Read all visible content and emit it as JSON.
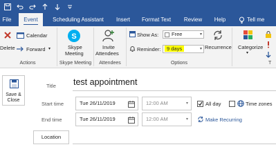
{
  "quick_access": {
    "icons": [
      "save-icon",
      "undo-icon",
      "redo-icon",
      "up-icon",
      "down-icon",
      "customize-icon"
    ]
  },
  "tabs": [
    {
      "label": "File",
      "active": false
    },
    {
      "label": "Event",
      "active": true
    },
    {
      "label": "Scheduling Assistant",
      "active": false
    },
    {
      "label": "Insert",
      "active": false
    },
    {
      "label": "Format Text",
      "active": false
    },
    {
      "label": "Review",
      "active": false
    },
    {
      "label": "Help",
      "active": false
    }
  ],
  "tell_me": "Tell me",
  "ribbon": {
    "delete_label": "Delete",
    "calendar_label": "Calendar",
    "forward_label": "Forward",
    "actions_label": "Actions",
    "skype_label_1": "Skype",
    "skype_label_2": "Meeting",
    "skype_group_label": "Skype Meeting",
    "invite_label_1": "Invite",
    "invite_label_2": "Attendees",
    "attendees_group_label": "Attendees",
    "show_as_label": "Show As:",
    "show_as_value": "Free",
    "reminder_label": "Reminder:",
    "reminder_value": "9 days",
    "recurrence_label": "Recurrence",
    "options_label": "Options",
    "categorize_label": "Categorize"
  },
  "form": {
    "save_close_1": "Save &",
    "save_close_2": "Close",
    "title_label": "Title",
    "title_value": "test appointment",
    "start_label": "Start time",
    "start_date": "Tue 26/11/2019",
    "start_time": "12:00 AM",
    "all_day_label": "All day",
    "all_day_checked": true,
    "time_zones_label": "Time zones",
    "end_label": "End time",
    "end_date": "Tue 26/11/2019",
    "end_time": "12:00 AM",
    "make_recurring_label": "Make Recurring",
    "location_label": "Location"
  },
  "colors": {
    "accent": "#2b579a",
    "highlight": "#ffff00"
  }
}
